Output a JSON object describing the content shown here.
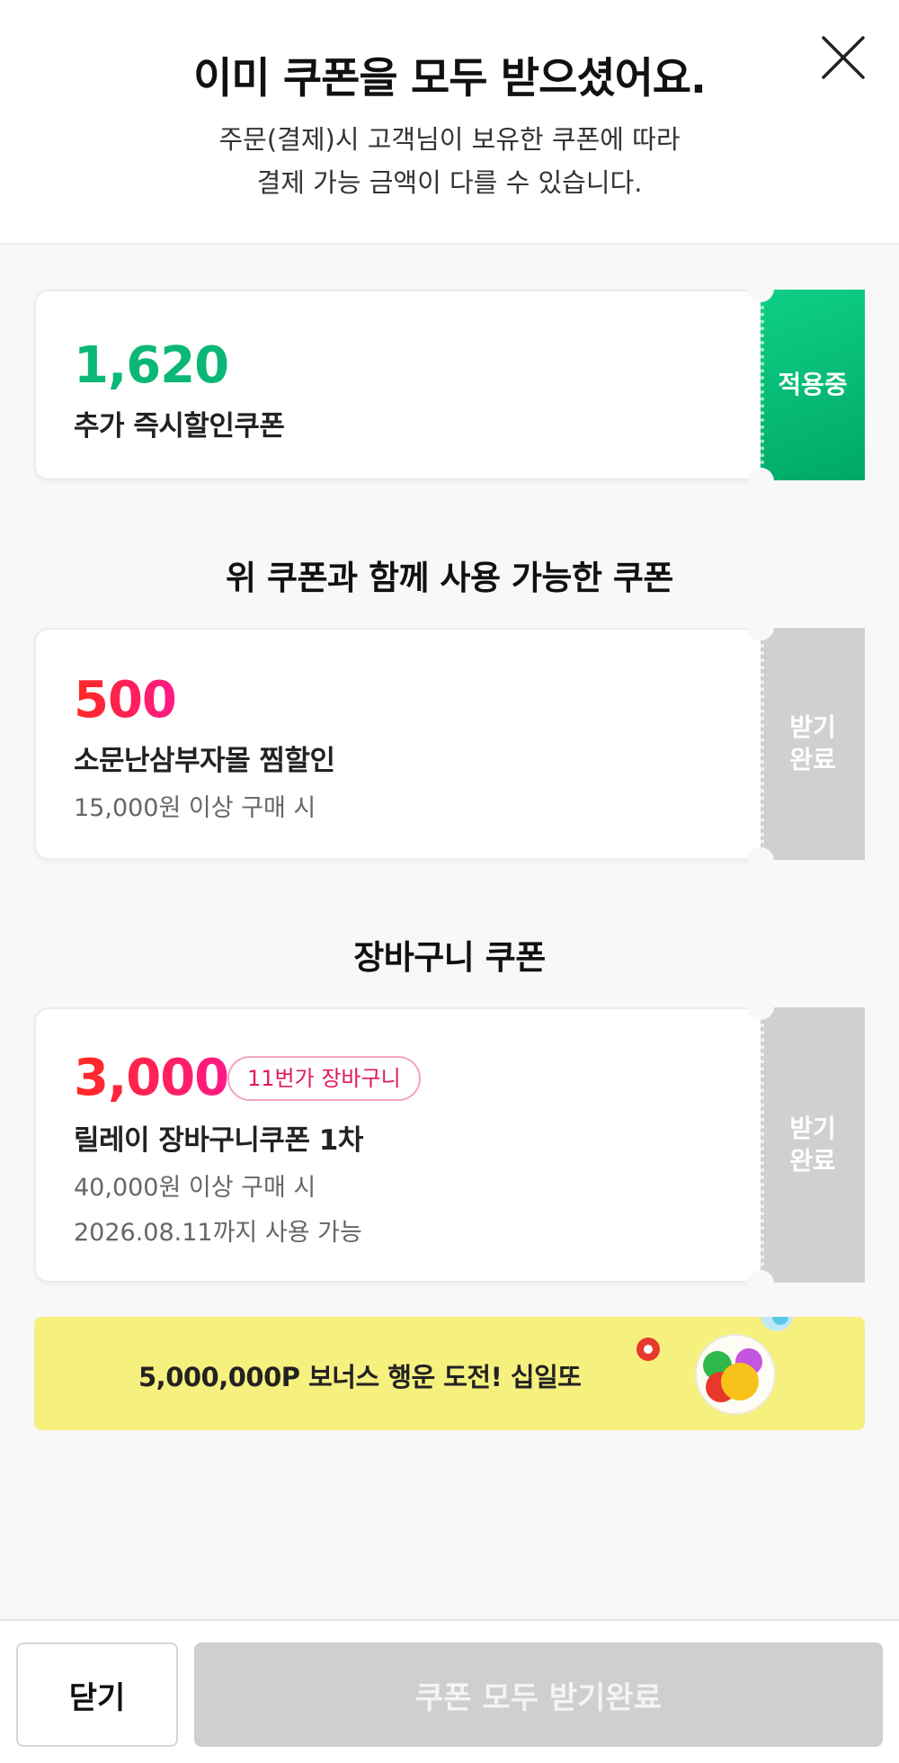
{
  "header": {
    "title": "이미 쿠폰을 모두 받으셨어요.",
    "subtitle_line1": "주문(결제)시 고객님이 보유한 쿠폰에 따라",
    "subtitle_line2": "결제 가능 금액이 다를 수 있습니다.",
    "close_icon": "close-icon"
  },
  "applied_coupon": {
    "amount": "1,620",
    "name": "추가 즉시할인쿠폰",
    "status": "적용중",
    "accent": "#0ab776"
  },
  "section_combinable": {
    "title": "위 쿠폰과 함께 사용 가능한 쿠폰",
    "coupons": [
      {
        "amount": "500",
        "name": "소문난삼부자몰 찜할인",
        "condition": "15,000원 이상 구매 시",
        "status_line1": "받기",
        "status_line2": "완료"
      }
    ]
  },
  "section_cart": {
    "title": "장바구니 쿠폰",
    "coupons": [
      {
        "amount": "3,000",
        "badge": "11번가 장바구니",
        "name": "릴레이 장바구니쿠폰 1차",
        "condition": "40,000원 이상 구매 시",
        "expiry": "2026.08.11까지 사용 가능",
        "status_line1": "받기",
        "status_line2": "완료"
      }
    ]
  },
  "banner": {
    "text": "5,000,000P 보너스 행운 도전! 십일또",
    "icon": "lotto-balls-icon",
    "background": "#f6f07f"
  },
  "footer": {
    "close_label": "닫기",
    "all_label": "쿠폰 모두 받기완료"
  }
}
